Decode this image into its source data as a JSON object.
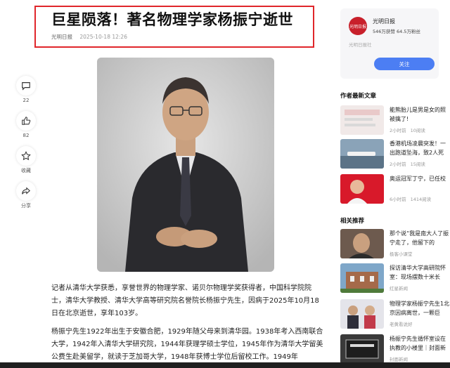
{
  "article": {
    "title": "巨星陨落！著名物理学家杨振宁逝世",
    "source": "光明日报",
    "date": "2025-10-18 12:26",
    "para1": "记者从清华大学获悉，享誉世界的物理学家、诺贝尔物理学奖获得者，中国科学院院士，清华大学教授、清华大学高等研究院名誉院长杨振宁先生，因病于2025年10月18日在北京逝世，享年103岁。",
    "para2": "杨振宁先生1922年出生于安徽合肥，1929年随父母来到清华园。1938年考入西南联合大学，1942年入清华大学研究院，1944年获理学硕士学位，1945年作为清华大学留美公费生赴美留学，就读于芝加哥大学，1948年获博士学位后留校工作。1949年"
  },
  "rail": {
    "comment_count": "22",
    "like_count": "82",
    "collect_label": "收藏",
    "share_label": "分享"
  },
  "author": {
    "logo_text": "光明日报",
    "name": "光明日报",
    "stats": "546万获赞  64.5万粉丝",
    "desc": "光明日报社",
    "follow_label": "关注"
  },
  "latest": {
    "title": "作者最新文章",
    "items": [
      {
        "text": "能熊胎儿是男是女的照被擒了!",
        "time": "2小时前",
        "reads": "10阅读"
      },
      {
        "text": "香港机场凌晨突发！一出跑道坠海，致2人死",
        "time": "2小时前",
        "reads": "15阅读"
      },
      {
        "text": "奥运冠军丁宁，已任校",
        "time": "6小时前",
        "reads": "1414阅读"
      }
    ]
  },
  "related": {
    "title": "相关推荐",
    "items": [
      {
        "text": "那个说“我是南大人了振宁走了，他留下的",
        "source": "极客小课堂"
      },
      {
        "text": "探访清华大学高研院怀室：现场摆数十米长",
        "source": "红星新闻"
      },
      {
        "text": "物理学家杨振宁先生1北京因病离世，一颗巨",
        "source": "老黄看说好"
      },
      {
        "text": "杨振宁先生循怀室设在执教的小楼里｜封面新",
        "source": "封面新闻"
      }
    ]
  }
}
